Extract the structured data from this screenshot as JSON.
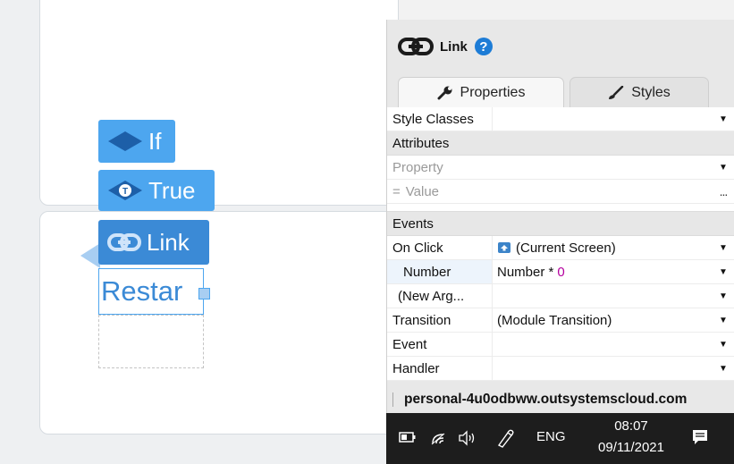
{
  "canvas": {
    "widgets": {
      "if_label": "If",
      "true_label": "True",
      "link_label": "Link",
      "restart_text": "Restar"
    }
  },
  "panel": {
    "title": "Link",
    "help_symbol": "?",
    "tabs": [
      {
        "label": "Properties",
        "icon": "wrench-icon",
        "active": true
      },
      {
        "label": "Styles",
        "icon": "brush-icon",
        "active": false
      }
    ],
    "rows": {
      "style_classes": {
        "name": "Style Classes",
        "value": "",
        "dropdown": "▼"
      },
      "attributes_section": "Attributes",
      "property": {
        "placeholder": "Property",
        "dropdown": "▼"
      },
      "value": {
        "eq": "=",
        "placeholder": "Value",
        "more": "..."
      },
      "events_section": "Events",
      "on_click": {
        "name": "On Click",
        "value": "(Current Screen)",
        "icon": "screen-icon",
        "dropdown": "▼"
      },
      "number": {
        "name": "Number",
        "value": "Number *",
        "accent_value": "0",
        "dropdown": "▼"
      },
      "new_arg": {
        "name": "(New Arg...",
        "value": "",
        "dropdown": "▼"
      },
      "transition": {
        "name": "Transition",
        "value": "(Module Transition)",
        "dropdown": "▼"
      },
      "event": {
        "name": "Event",
        "value": "",
        "dropdown": "▼"
      },
      "handler": {
        "name": "Handler",
        "value": "",
        "dropdown": "▼"
      }
    },
    "url": "personal-4u0odbww.outsystemscloud.com"
  },
  "taskbar": {
    "language": "ENG",
    "time": "08:07",
    "date": "09/11/2021",
    "icons": [
      "battery-icon",
      "wifi-icon",
      "volume-icon",
      "pen-icon",
      "notifications-icon"
    ]
  },
  "colors": {
    "widget_blue": "#4da6ef",
    "widget_blue_dark": "#3b8ad6",
    "help_blue": "#1d7cd6",
    "accent_number": "#b4009e",
    "taskbar_bg": "#1d1d1d"
  }
}
